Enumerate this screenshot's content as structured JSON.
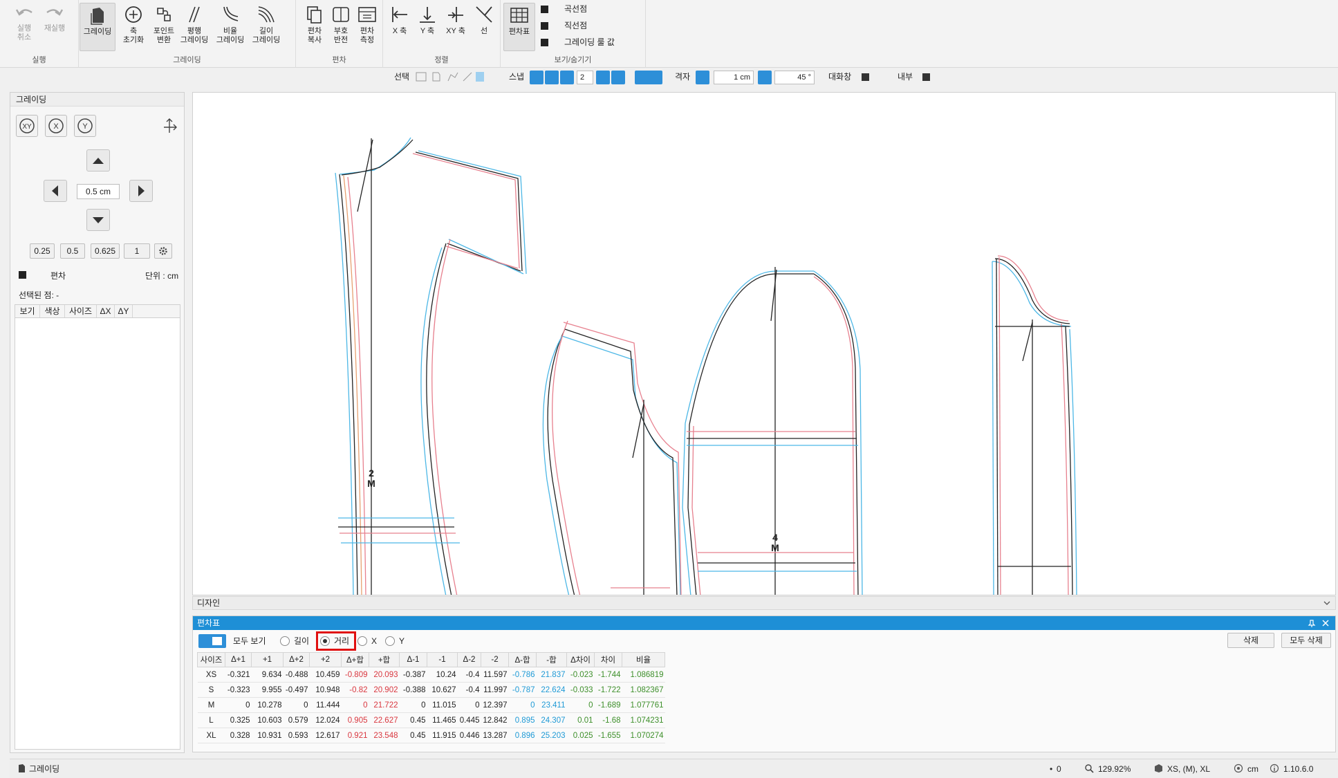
{
  "ribbon": {
    "groups": [
      {
        "label": "실행",
        "buttons": [
          "실행\n취소",
          "재실행"
        ]
      },
      {
        "label": "그레이딩",
        "buttons": [
          "그레이딩",
          "축\n초기화",
          "포인트\n변환",
          "평행\n그레이딩",
          "비율\n그레이딩",
          "길이\n그레이딩"
        ]
      },
      {
        "label": "편차",
        "buttons": [
          "편차\n복사",
          "부호\n반전",
          "편차\n측정"
        ]
      },
      {
        "label": "정렬",
        "buttons": [
          "X 축",
          "Y 축",
          "XY 축",
          "선"
        ]
      },
      {
        "label": "보기/숨기기",
        "buttons": [
          "편차표"
        ]
      }
    ],
    "visibility": [
      "곡선점",
      "직선점",
      "그레이딩 룰 값"
    ]
  },
  "toolbar": {
    "select_label": "선택",
    "snap_label": "스냅",
    "snap_value": "2",
    "grid_label": "격자",
    "grid_value": "1 cm",
    "angle_value": "45 °",
    "dialog_label": "대화창",
    "inner_label": "내부"
  },
  "left_panel": {
    "title": "그레이딩",
    "axis_buttons": [
      "XY",
      "X",
      "Y"
    ],
    "step_value": "0.5 cm",
    "presets": [
      "0.25",
      "0.5",
      "0.625",
      "1"
    ],
    "deviation_label": "편차",
    "unit_label": "단위 : cm",
    "selected_point": "선택된 점: -",
    "columns": [
      "보기",
      "색상",
      "사이즈",
      "ΔX",
      "ΔY"
    ]
  },
  "canvas": {
    "piece_labels": [
      {
        "num": "2",
        "size": "M"
      },
      {
        "num": "4",
        "size": "M"
      }
    ]
  },
  "design_bar": {
    "label": "디자인"
  },
  "deviation_table": {
    "title": "편차표",
    "show_all": "모두 보기",
    "modes": [
      "길이",
      "거리",
      "X",
      "Y"
    ],
    "selected_mode": "거리",
    "delete": "삭제",
    "delete_all": "모두 삭제",
    "columns": [
      "사이즈",
      "Δ+1",
      "+1",
      "Δ+2",
      "+2",
      "Δ+합",
      "+합",
      "Δ-1",
      "-1",
      "Δ-2",
      "-2",
      "Δ-합",
      "-합",
      "Δ차이",
      "차이",
      "비율"
    ],
    "rows": [
      [
        "XS",
        "-0.321",
        "9.634",
        "-0.488",
        "10.459",
        "-0.809",
        "20.093",
        "-0.387",
        "10.24",
        "-0.4",
        "11.597",
        "-0.786",
        "21.837",
        "-0.023",
        "-1.744",
        "1.086819"
      ],
      [
        "S",
        "-0.323",
        "9.955",
        "-0.497",
        "10.948",
        "-0.82",
        "20.902",
        "-0.388",
        "10.627",
        "-0.4",
        "11.997",
        "-0.787",
        "22.624",
        "-0.033",
        "-1.722",
        "1.082367"
      ],
      [
        "M",
        "0",
        "10.278",
        "0",
        "11.444",
        "0",
        "21.722",
        "0",
        "11.015",
        "0",
        "12.397",
        "0",
        "23.411",
        "0",
        "-1.689",
        "1.077761"
      ],
      [
        "L",
        "0.325",
        "10.603",
        "0.579",
        "12.024",
        "0.905",
        "22.627",
        "0.45",
        "11.465",
        "0.445",
        "12.842",
        "0.895",
        "24.307",
        "0.01",
        "-1.68",
        "1.074231"
      ],
      [
        "XL",
        "0.328",
        "10.931",
        "0.593",
        "12.617",
        "0.921",
        "23.548",
        "0.45",
        "11.915",
        "0.446",
        "13.287",
        "0.896",
        "25.203",
        "0.025",
        "-1.655",
        "1.070274"
      ]
    ]
  },
  "statusbar": {
    "mode": "그레이딩",
    "points": "0",
    "zoom": "129.92%",
    "sizes": "XS, (M), XL",
    "unit": "cm",
    "version": "1.10.6.0"
  }
}
